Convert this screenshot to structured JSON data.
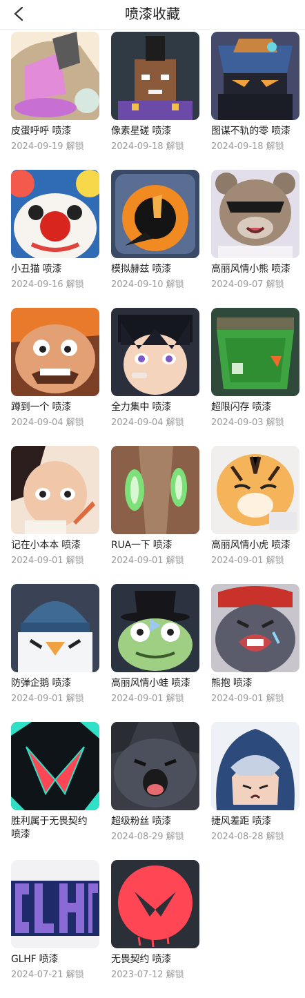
{
  "header": {
    "title": "喷漆收藏",
    "back_icon": "chevron-left-icon"
  },
  "items": [
    {
      "name": "皮蛋呼呼 喷漆",
      "date": "2024-09-19 解锁",
      "bg": "#f3e6d0"
    },
    {
      "name": "像素星磋 喷漆",
      "date": "2024-09-18 解锁",
      "bg": "#2f3a44"
    },
    {
      "name": "图谋不轨的零 喷漆",
      "date": "2024-09-18 解锁",
      "bg": "#3b3f5a"
    },
    {
      "name": "小丑猫 喷漆",
      "date": "2024-09-16 解锁",
      "bg": "#f6d84a"
    },
    {
      "name": "模拟赫兹 喷漆",
      "date": "2024-09-10 解锁",
      "bg": "#3a4a66"
    },
    {
      "name": "高丽风情小熊 喷漆",
      "date": "2024-09-07 解锁",
      "bg": "#d9d4e4"
    },
    {
      "name": "蹲到一个 喷漆",
      "date": "2024-09-04 解锁",
      "bg": "#b8542c"
    },
    {
      "name": "全力集中 喷漆",
      "date": "2024-09-04 解锁",
      "bg": "#2b2f3b"
    },
    {
      "name": "超限闪存 喷漆",
      "date": "2024-09-03 解锁",
      "bg": "#2a3a2f"
    },
    {
      "name": "记在小本本 喷漆",
      "date": "2024-09-01 解锁",
      "bg": "#f1dfcf"
    },
    {
      "name": "RUA一下 喷漆",
      "date": "2024-09-01 解锁",
      "bg": "#9a7558"
    },
    {
      "name": "高丽风情小虎 喷漆",
      "date": "2024-09-01 解锁",
      "bg": "#eceae8"
    },
    {
      "name": "防弹企鹅 喷漆",
      "date": "2024-09-01 解锁",
      "bg": "#3a4356"
    },
    {
      "name": "高丽风情小蛙 喷漆",
      "date": "2024-09-01 解锁",
      "bg": "#2b3340"
    },
    {
      "name": "熊抱 喷漆",
      "date": "2024-09-01 解锁",
      "bg": "#4b4d5c"
    },
    {
      "name": "胜利属于无畏契约 喷漆",
      "date": "",
      "bg": "#101418"
    },
    {
      "name": "超级粉丝 喷漆",
      "date": "2024-08-29 解锁",
      "bg": "#3a3c46"
    },
    {
      "name": "捷风差距 喷漆",
      "date": "2024-08-28 解锁",
      "bg": "#eef1f6"
    },
    {
      "name": "GLHF 喷漆",
      "date": "2024-07-21 解锁",
      "bg": "#1a1f3a"
    },
    {
      "name": "无畏契约 喷漆",
      "date": "2023-07-12 解锁",
      "bg": "#2a2f38"
    }
  ]
}
